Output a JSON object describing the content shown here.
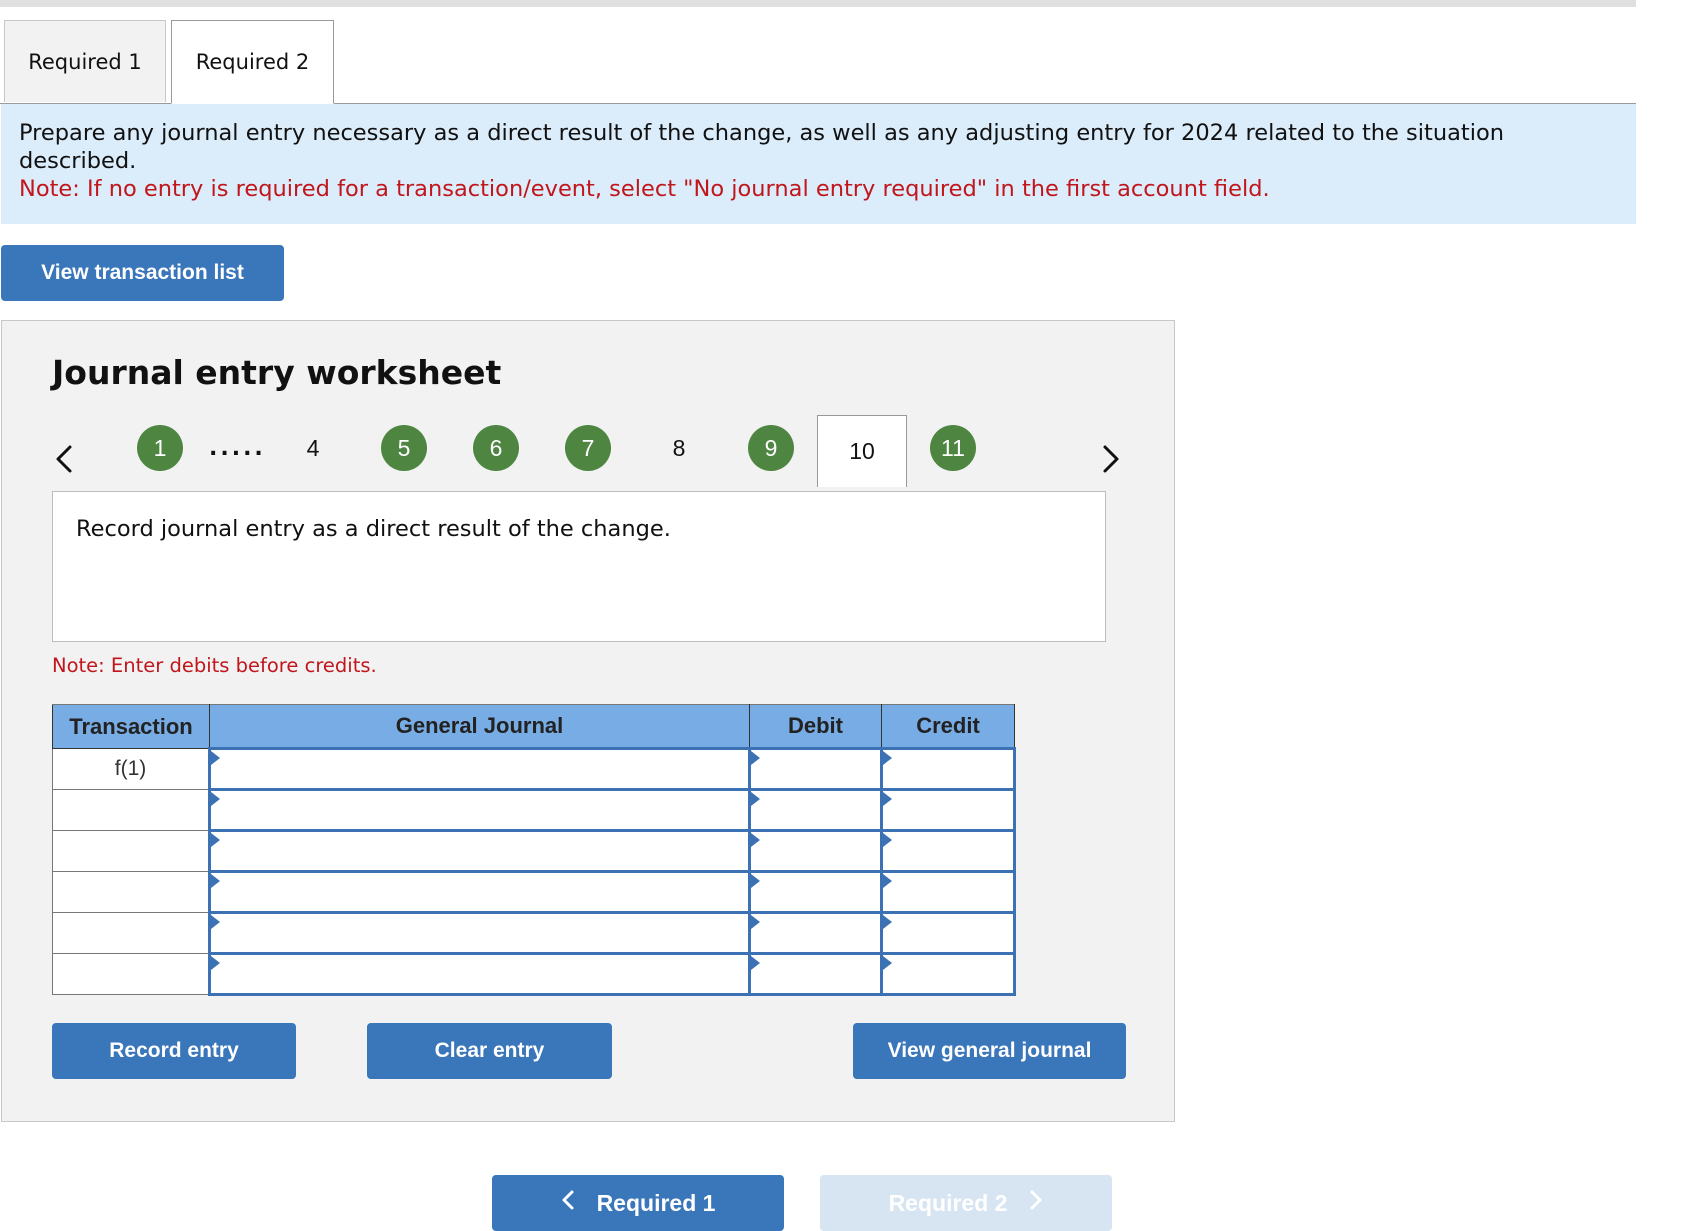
{
  "tabs": [
    {
      "label": "Required 1",
      "active": false
    },
    {
      "label": "Required 2",
      "active": true
    }
  ],
  "instructions": {
    "text": "Prepare any journal entry necessary as a direct result of the change, as well as any adjusting entry for 2024 related to the situation described.",
    "note": "Note: If no entry is required for a transaction/event, select \"No journal entry required\" in the first account field."
  },
  "view_transaction_list_label": "View transaction list",
  "worksheet": {
    "title": "Journal entry worksheet",
    "nav": {
      "prev_icon": "chevron-left-icon",
      "next_icon": "chevron-right-icon",
      "items": [
        {
          "label": "1",
          "state": "done"
        },
        {
          "label": ".....",
          "state": "ellipsis"
        },
        {
          "label": "4",
          "state": "plain"
        },
        {
          "label": "5",
          "state": "done"
        },
        {
          "label": "6",
          "state": "done"
        },
        {
          "label": "7",
          "state": "done"
        },
        {
          "label": "8",
          "state": "plain"
        },
        {
          "label": "9",
          "state": "done"
        },
        {
          "label": "10",
          "state": "current"
        },
        {
          "label": "11",
          "state": "done"
        }
      ]
    },
    "instruction": "Record journal entry as a direct result of the change.",
    "note": "Note: Enter debits before credits.",
    "table": {
      "headers": [
        "Transaction",
        "General Journal",
        "Debit",
        "Credit"
      ],
      "rows": [
        {
          "transaction": "f(1)",
          "account": "",
          "debit": "",
          "credit": ""
        },
        {
          "transaction": "",
          "account": "",
          "debit": "",
          "credit": ""
        },
        {
          "transaction": "",
          "account": "",
          "debit": "",
          "credit": ""
        },
        {
          "transaction": "",
          "account": "",
          "debit": "",
          "credit": ""
        },
        {
          "transaction": "",
          "account": "",
          "debit": "",
          "credit": ""
        },
        {
          "transaction": "",
          "account": "",
          "debit": "",
          "credit": ""
        }
      ]
    },
    "buttons": {
      "record": "Record entry",
      "clear": "Clear entry",
      "view_journal": "View general journal"
    }
  },
  "bottom_nav": {
    "prev_label": "Required 1",
    "next_label": "Required 2",
    "next_disabled": true
  },
  "colors": {
    "accent_blue": "#3a76ba",
    "done_green": "#4e8540",
    "note_red": "#c0161c",
    "header_blue": "#78ace5",
    "info_bg": "#dbecfa"
  }
}
